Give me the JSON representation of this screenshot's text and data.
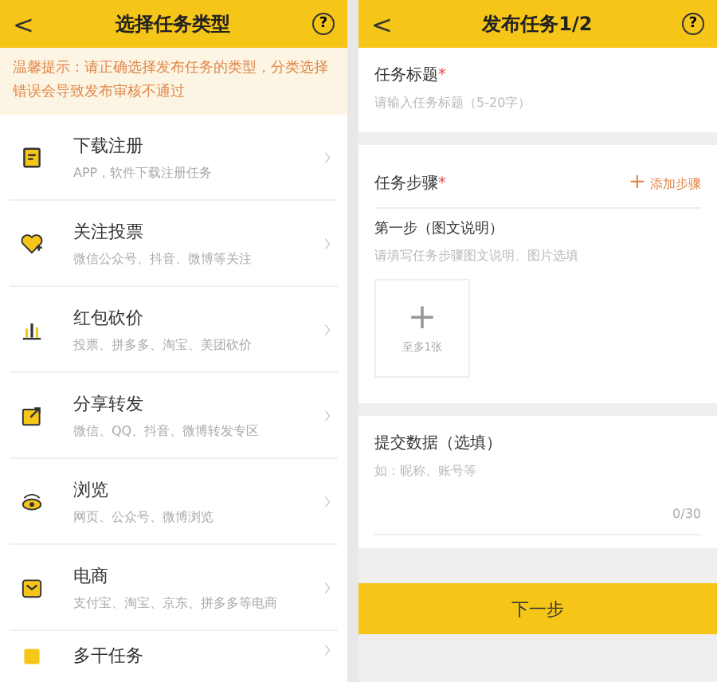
{
  "left_screen": {
    "header": {
      "back": "<",
      "title": "选择任务类型",
      "help": "?"
    },
    "notice": "温馨提示：请正确选择发布任务的类型，分类选择错误会导致发布审核不通过",
    "task_types": [
      {
        "kind": "download",
        "name": "下载注册",
        "desc": "APP，软件下载注册任务"
      },
      {
        "kind": "follow",
        "name": "关注投票",
        "desc": "微信公众号、抖音、微博等关注"
      },
      {
        "kind": "bargain",
        "name": "红包砍价",
        "desc": "投票、拼多多、淘宝、美团砍价"
      },
      {
        "kind": "share",
        "name": "分享转发",
        "desc": "微信、QQ、抖音、微博转发专区"
      },
      {
        "kind": "browse",
        "name": "浏览",
        "desc": "网页、公众号、微博浏览"
      },
      {
        "kind": "ecommerce",
        "name": "电商",
        "desc": "支付宝、淘宝、京东、拼多多等电商"
      },
      {
        "kind": "other",
        "name": "多干任务"
      }
    ]
  },
  "right_screen": {
    "header": {
      "back": "<",
      "title": "发布任务1/2",
      "help": "?"
    },
    "title_field": {
      "label": "任务标题",
      "required_mark": "*",
      "placeholder": "请输入任务标题（5-20字）"
    },
    "steps": {
      "label": "任务步骤",
      "required_mark": "*",
      "add_icon": "+",
      "add_label": "添加步骤",
      "step_title": "第一步（图文说明）",
      "placeholder": "请填写任务步骤图文说明、图片选填",
      "upload_icon": "+",
      "upload_hint": "至多1张"
    },
    "submit_data": {
      "label": "提交数据（选填）",
      "placeholder": "如：昵称、账号等",
      "counter": "0/30"
    },
    "next_button": "下一步"
  }
}
